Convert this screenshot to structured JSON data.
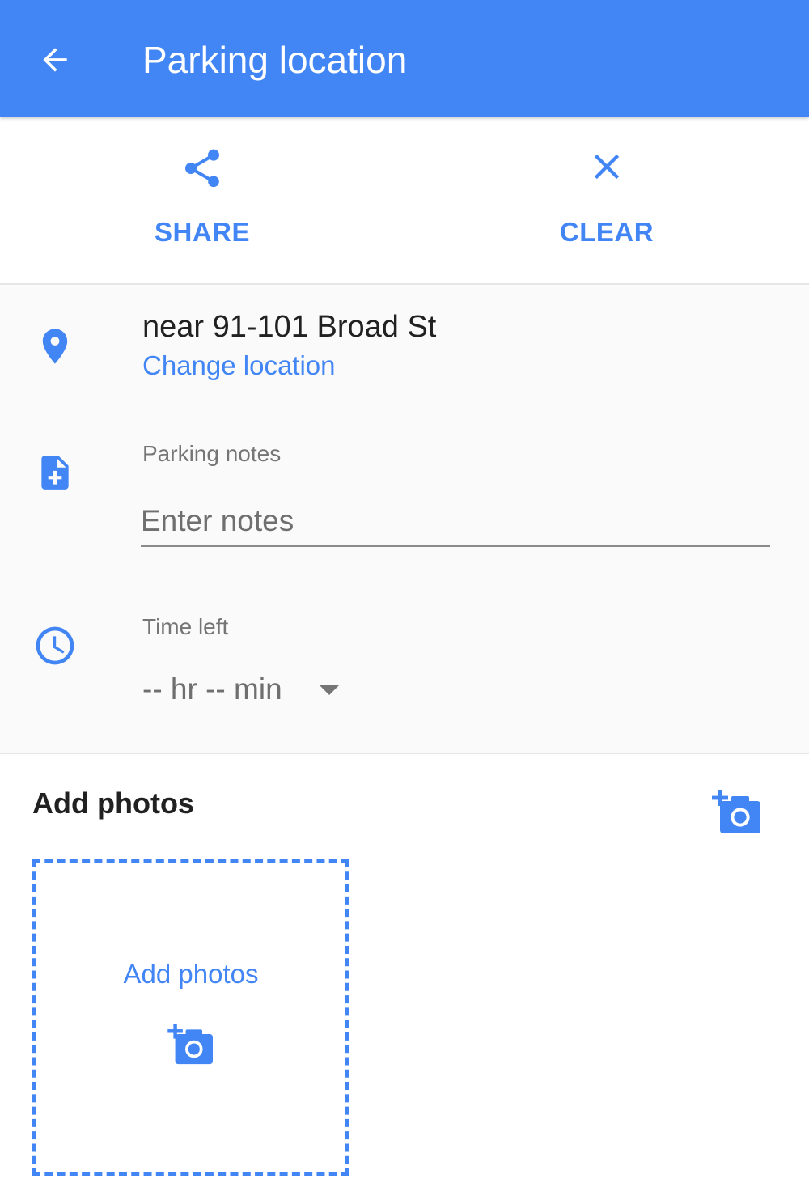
{
  "appbar": {
    "title": "Parking location",
    "back_icon": "arrow-back-icon",
    "color": "#4285f4"
  },
  "actions": {
    "share": {
      "label": "SHARE",
      "icon": "share-icon"
    },
    "clear": {
      "label": "CLEAR",
      "icon": "close-icon"
    }
  },
  "location": {
    "icon": "location-pin-icon",
    "address": "near 91-101 Broad St",
    "change_label": "Change location"
  },
  "notes": {
    "icon": "note-add-icon",
    "label": "Parking notes",
    "placeholder": "Enter notes",
    "value": ""
  },
  "time_left": {
    "icon": "clock-icon",
    "label": "Time left",
    "value": "-- hr -- min",
    "dropdown_icon": "caret-down-icon"
  },
  "photos": {
    "title": "Add photos",
    "add_icon": "add-photo-icon",
    "drop_zone_label": "Add photos"
  },
  "colors": {
    "accent": "#4285f4",
    "text_primary": "#212121",
    "text_secondary": "#757575"
  }
}
